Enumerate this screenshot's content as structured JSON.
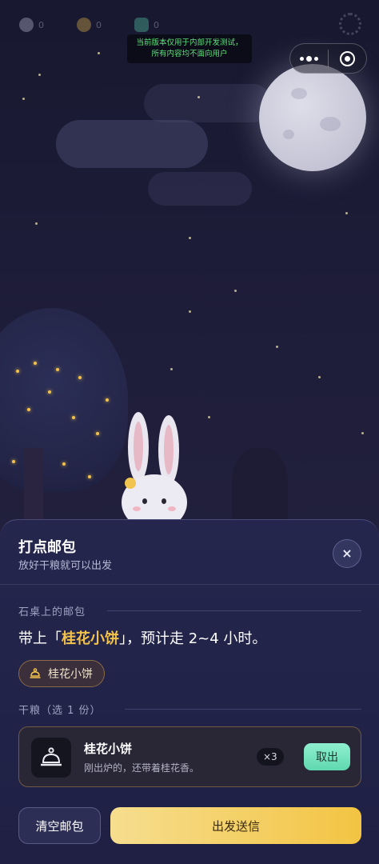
{
  "notice": {
    "line1": "当前版本仅用于内部开发测试，",
    "line2": "所有内容均不面向用户"
  },
  "capsule": {
    "more_icon": "more-dots-icon",
    "target_icon": "close-target-icon"
  },
  "sheet": {
    "title": "打点邮包",
    "subtitle": "放好干粮就可以出发",
    "close_label": "×",
    "table_section": "石桌上的邮包",
    "carry_prefix": "带上「",
    "carry_item": "桂花小饼",
    "carry_suffix": "」，预计走 2~4 小时。",
    "chip_label": "桂花小饼",
    "food_section": "干粮（选 1 份）",
    "item": {
      "name": "桂花小饼",
      "desc": "刚出炉的，还带着桂花香。",
      "qty": "×3",
      "take_label": "取出"
    },
    "clear_label": "清空邮包",
    "send_label": "出发送信"
  },
  "colors": {
    "accent_gold": "#f3c24a",
    "accent_mint": "#6fe0bc",
    "sheet_bg": "#24264d"
  }
}
